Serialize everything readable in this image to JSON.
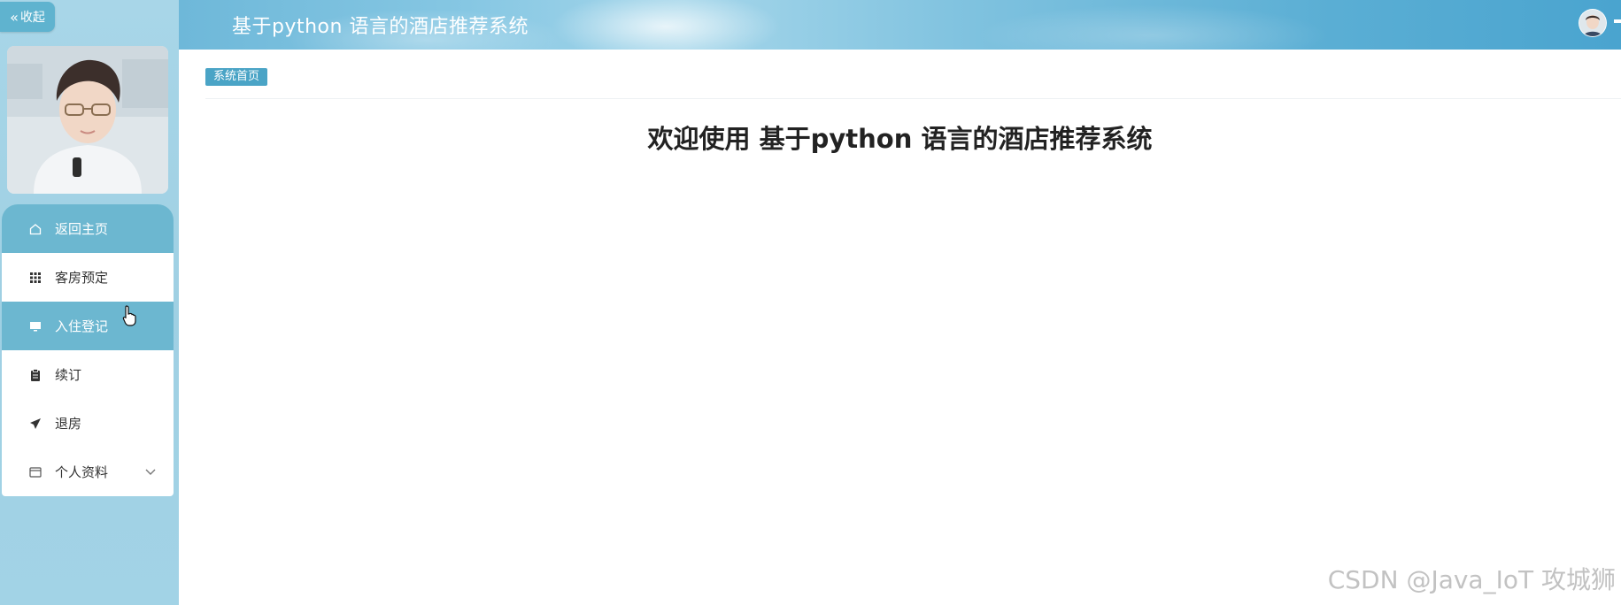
{
  "sidebar": {
    "collapse_label": "收起",
    "menu": [
      {
        "label": "返回主页",
        "icon": "home-icon"
      },
      {
        "label": "客房预定",
        "icon": "grid-icon"
      },
      {
        "label": "入住登记",
        "icon": "monitor-icon"
      },
      {
        "label": "续订",
        "icon": "clipboard-icon"
      },
      {
        "label": "退房",
        "icon": "send-icon"
      },
      {
        "label": "个人资料",
        "icon": "wallet-icon"
      }
    ]
  },
  "header": {
    "title": "基于python 语言的酒店推荐系统"
  },
  "main": {
    "breadcrumb": "系统首页",
    "welcome": "欢迎使用 基于python 语言的酒店推荐系统"
  },
  "watermark": "CSDN @Java_IoT 攻城狮",
  "colors": {
    "sidebar_bg": "#a8d6e8",
    "active_item": "#6cb7d0",
    "header_accent": "#5aaed4",
    "breadcrumb_bg": "#4aa4c6"
  }
}
